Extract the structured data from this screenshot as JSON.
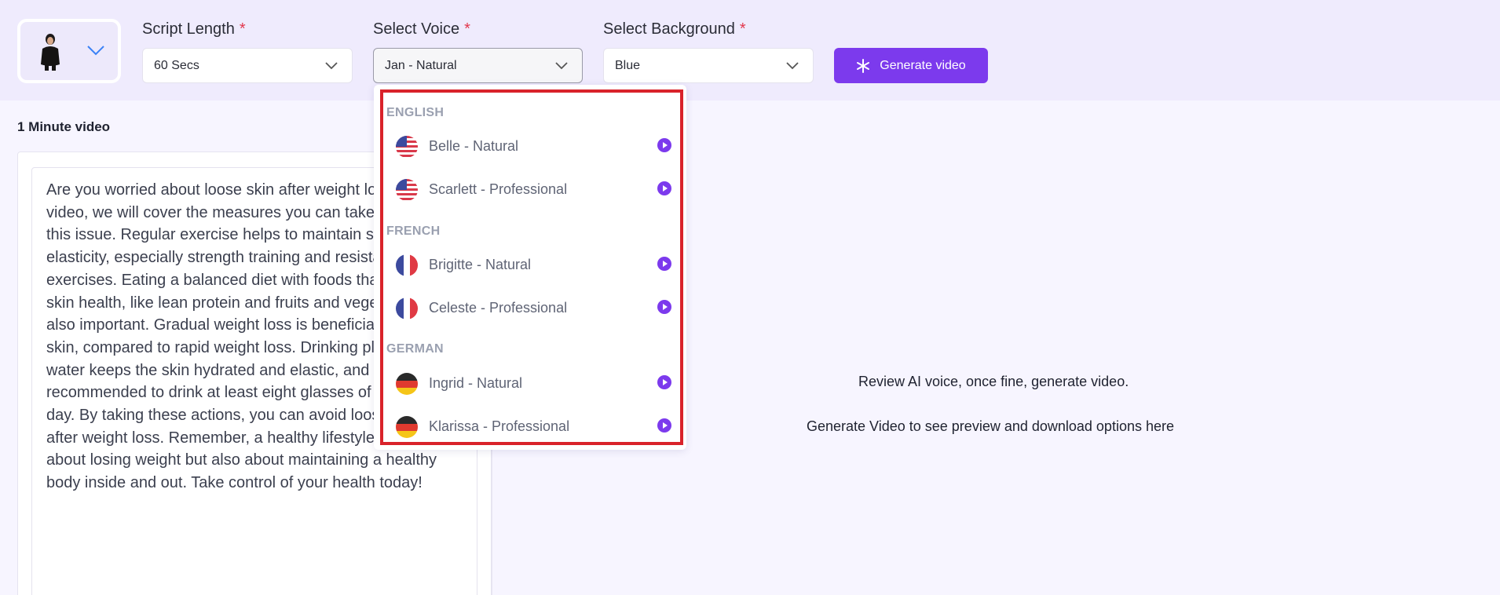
{
  "header": {
    "script_length": {
      "label": "Script Length",
      "required": "*",
      "value": "60 Secs"
    },
    "voice": {
      "label": "Select Voice",
      "required": "*",
      "value": "Jan - Natural"
    },
    "background": {
      "label": "Select Background",
      "required": "*",
      "value": "Blue"
    },
    "generate_label": "Generate video"
  },
  "editor": {
    "section_title": "1 Minute video",
    "script_lines": [
      "Are you worried about loose skin after weight loss? In this",
      "video, we will cover the measures you can take to avoid",
      "this issue. Regular exercise helps to maintain skin",
      "elasticity, especially strength training and resistance",
      "exercises. Eating a balanced diet with foods that support",
      "skin health, like lean protein and fruits and vegetables, is",
      "also important. Gradual weight loss is beneficial for your",
      "skin, compared to rapid weight loss. Drinking plenty of",
      "water keeps the skin hydrated and elastic, and it is",
      "recommended to drink at least eight glasses of water a",
      "day. By taking these actions, you can avoid loose skin",
      "after weight loss. Remember, a healthy lifestyle is not just",
      "about losing weight but also about maintaining a healthy",
      "body inside and out. Take control of your health today!"
    ]
  },
  "preview": {
    "review_text": "Review AI voice, once fine, generate video.",
    "preview_text": "Generate Video to see preview and download options here"
  },
  "voice_dropdown": {
    "groups": [
      {
        "label": "ENGLISH",
        "voices": [
          {
            "name": "Belle - Natural",
            "flag": "us-flag-icon"
          },
          {
            "name": "Scarlett - Professional",
            "flag": "us-flag-icon"
          }
        ]
      },
      {
        "label": "FRENCH",
        "voices": [
          {
            "name": "Brigitte - Natural",
            "flag": "fr-flag-icon"
          },
          {
            "name": "Celeste - Professional",
            "flag": "fr-flag-icon"
          }
        ]
      },
      {
        "label": "GERMAN",
        "voices": [
          {
            "name": "Ingrid - Natural",
            "flag": "de-flag-icon"
          },
          {
            "name": "Klarissa - Professional",
            "flag": "de-flag-icon"
          }
        ]
      }
    ]
  },
  "colors": {
    "accent": "#7c3aed",
    "header_bg": "#efebfd",
    "page_bg": "#f7f5ff",
    "required": "#e2384d",
    "highlight": "#d9222a"
  }
}
